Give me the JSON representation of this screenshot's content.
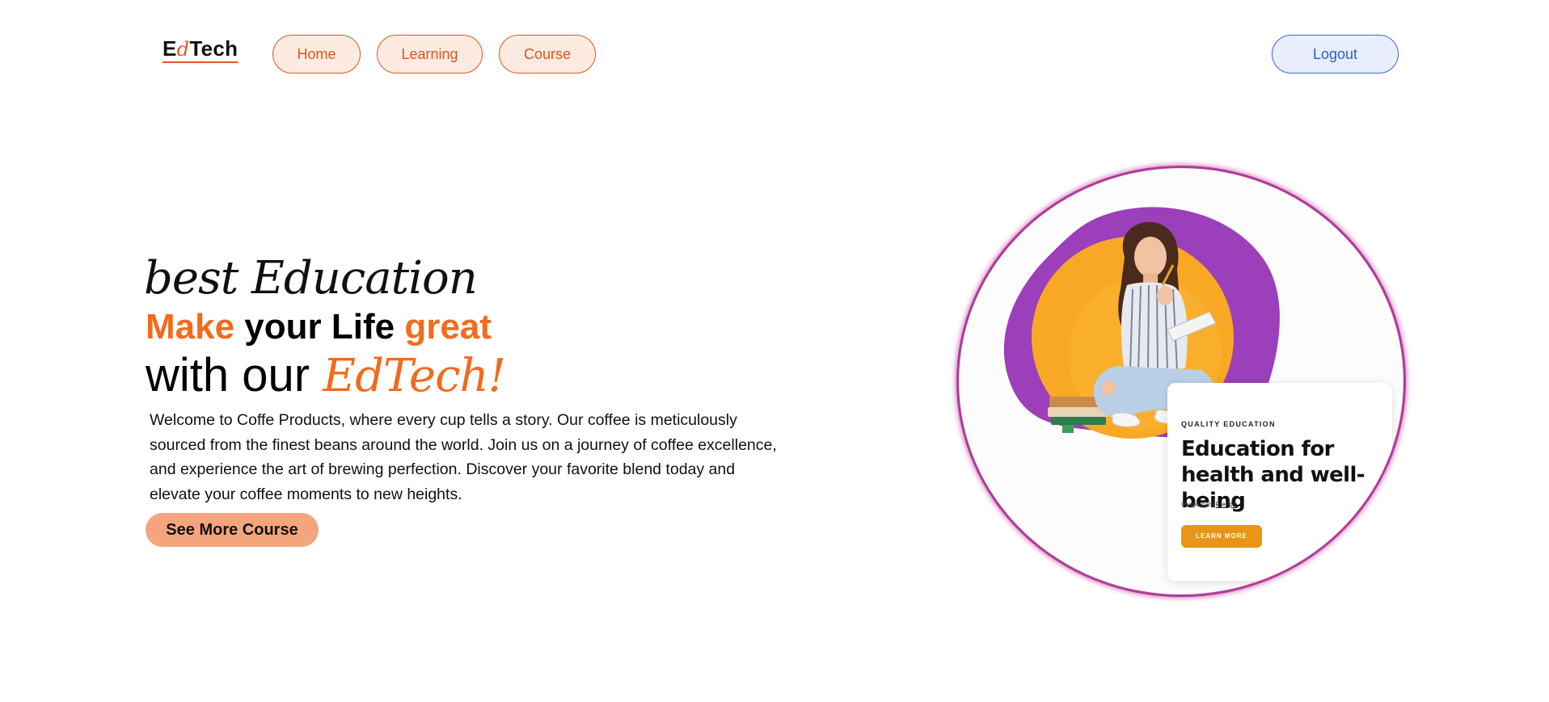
{
  "header": {
    "logo": {
      "prefix": "E",
      "accent": "d",
      "suffix": "Tech"
    },
    "nav": [
      {
        "label": "Home"
      },
      {
        "label": "Learning"
      },
      {
        "label": "Course"
      }
    ],
    "logout_label": "Logout"
  },
  "hero": {
    "tagline": "best Education",
    "headline_line1": {
      "part1": "Make",
      "part2": " your Life ",
      "part3": "great"
    },
    "headline_line2": {
      "plain": "with our ",
      "script": "EdTech!"
    },
    "description": "Welcome to Coffe Products, where every cup tells a story. Our coffee is meticulously sourced from the finest beans around the world. Join us on a journey of coffee excellence, and experience the art of brewing perfection. Discover your favorite blend today and elevate your coffee moments to new heights.",
    "cta_label": "See More Course"
  },
  "hero_image": {
    "card": {
      "kicker": "QUALITY EDUCATION",
      "title": "Education for health and well-being",
      "credit_prefix": "Image from ",
      "credit_link": "Freepik",
      "button_label": "LEARN MORE"
    }
  },
  "colors": {
    "accent_orange": "#f26b1d",
    "nav_border": "#e0561a",
    "logout_blue": "#2f5bd3",
    "cta_bg": "#f4a57e",
    "circle_border": "#b03a9a",
    "blob_purple": "#9c3fba",
    "photo_orange": "#f9a825",
    "card_button": "#ea9418"
  }
}
